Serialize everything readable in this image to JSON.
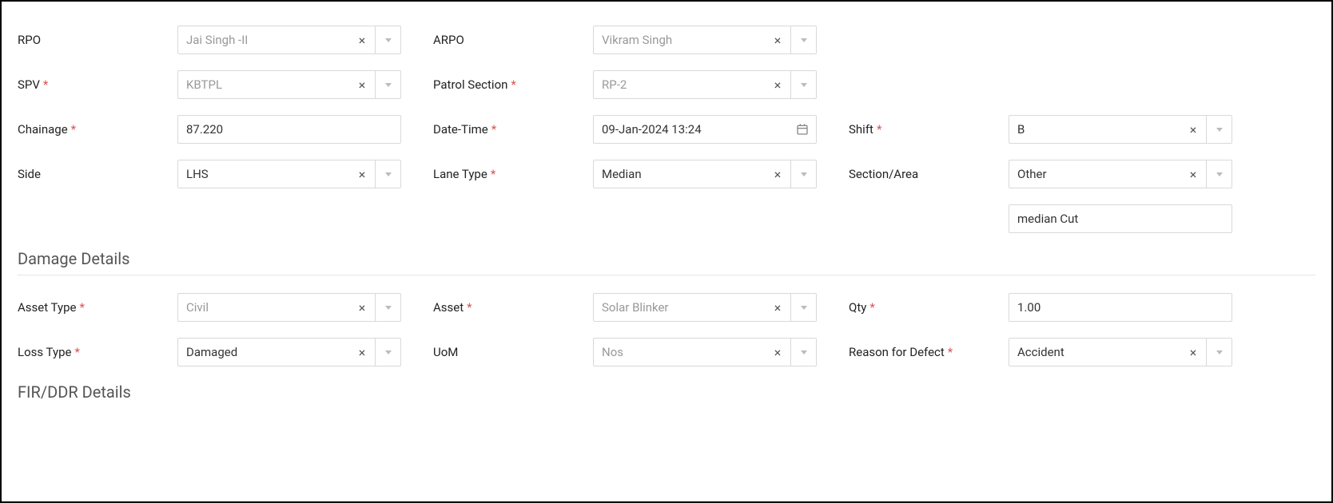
{
  "labels": {
    "rpo": "RPO",
    "arpo": "ARPO",
    "spv": "SPV",
    "patrol_section": "Patrol Section",
    "chainage": "Chainage",
    "datetime": "Date-Time",
    "shift": "Shift",
    "side": "Side",
    "lane_type": "Lane Type",
    "section_area": "Section/Area",
    "asset_type": "Asset Type",
    "asset": "Asset",
    "qty": "Qty",
    "loss_type": "Loss Type",
    "uom": "UoM",
    "reason_defect": "Reason for Defect"
  },
  "values": {
    "rpo": "Jai Singh -II",
    "arpo": "Vikram Singh",
    "spv": "KBTPL",
    "patrol_section": "RP-2",
    "chainage": "87.220",
    "datetime": "09-Jan-2024 13:24",
    "shift": "B",
    "side": "LHS",
    "lane_type": "Median",
    "section_area": "Other",
    "section_area_text": "median Cut",
    "asset_type": "Civil",
    "asset": "Solar Blinker",
    "qty": "1.00",
    "loss_type": "Damaged",
    "uom": "Nos",
    "reason_defect": "Accident"
  },
  "sections": {
    "damage": "Damage Details",
    "fir": "FIR/DDR Details"
  },
  "required": {
    "spv": true,
    "patrol_section": true,
    "chainage": true,
    "datetime": true,
    "shift": true,
    "lane_type": true,
    "asset_type": true,
    "asset": true,
    "qty": true,
    "loss_type": true,
    "reason_defect": true
  }
}
